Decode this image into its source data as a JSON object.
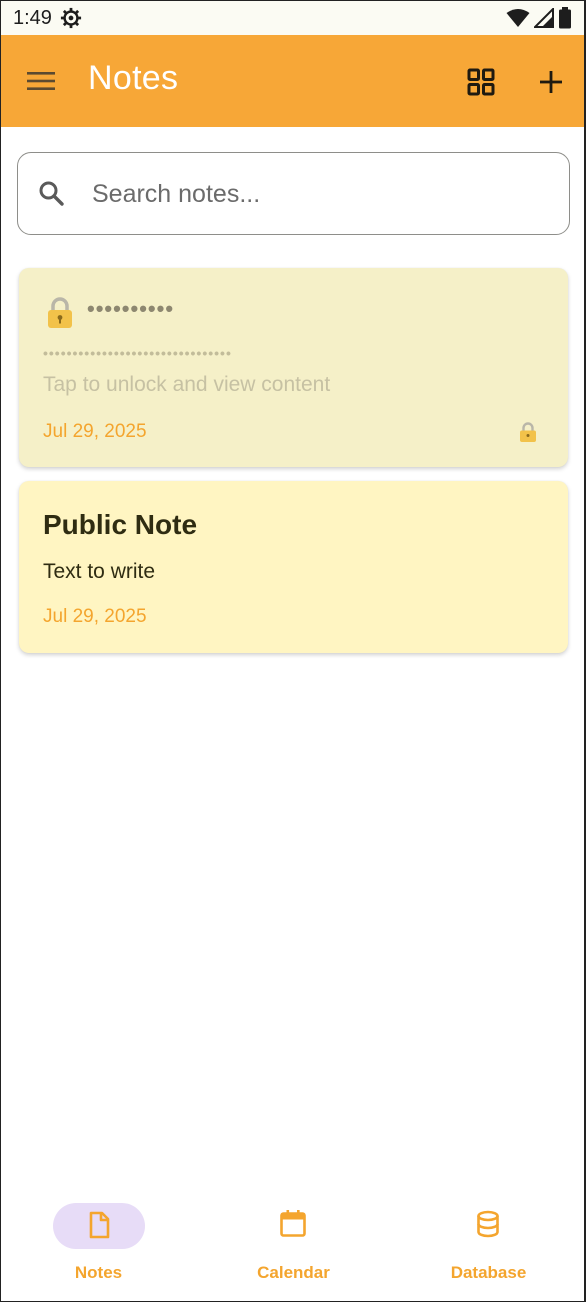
{
  "status_bar": {
    "time": "1:49"
  },
  "app_bar": {
    "title": "Notes"
  },
  "search": {
    "placeholder": "Search notes..."
  },
  "notes": [
    {
      "title_masked": "••••••••••",
      "content_masked": "••••••••••••••••••••••••••••••••",
      "hint": "Tap to unlock and view content",
      "date": "Jul 29, 2025",
      "locked": true
    },
    {
      "title": "Public Note",
      "content": "Text to write",
      "date": "Jul 29, 2025",
      "locked": false
    }
  ],
  "bottom_nav": {
    "items": [
      {
        "label": "Notes",
        "icon": "note-icon",
        "active": true
      },
      {
        "label": "Calendar",
        "icon": "calendar-icon",
        "active": false
      },
      {
        "label": "Database",
        "icon": "database-icon",
        "active": false
      }
    ]
  },
  "colors": {
    "accent": "#f7a737",
    "date": "#f4a52e",
    "locked_card": "#f5f0c8",
    "public_card": "#fff5c2",
    "nav_active_pill": "#e7dcf7"
  }
}
